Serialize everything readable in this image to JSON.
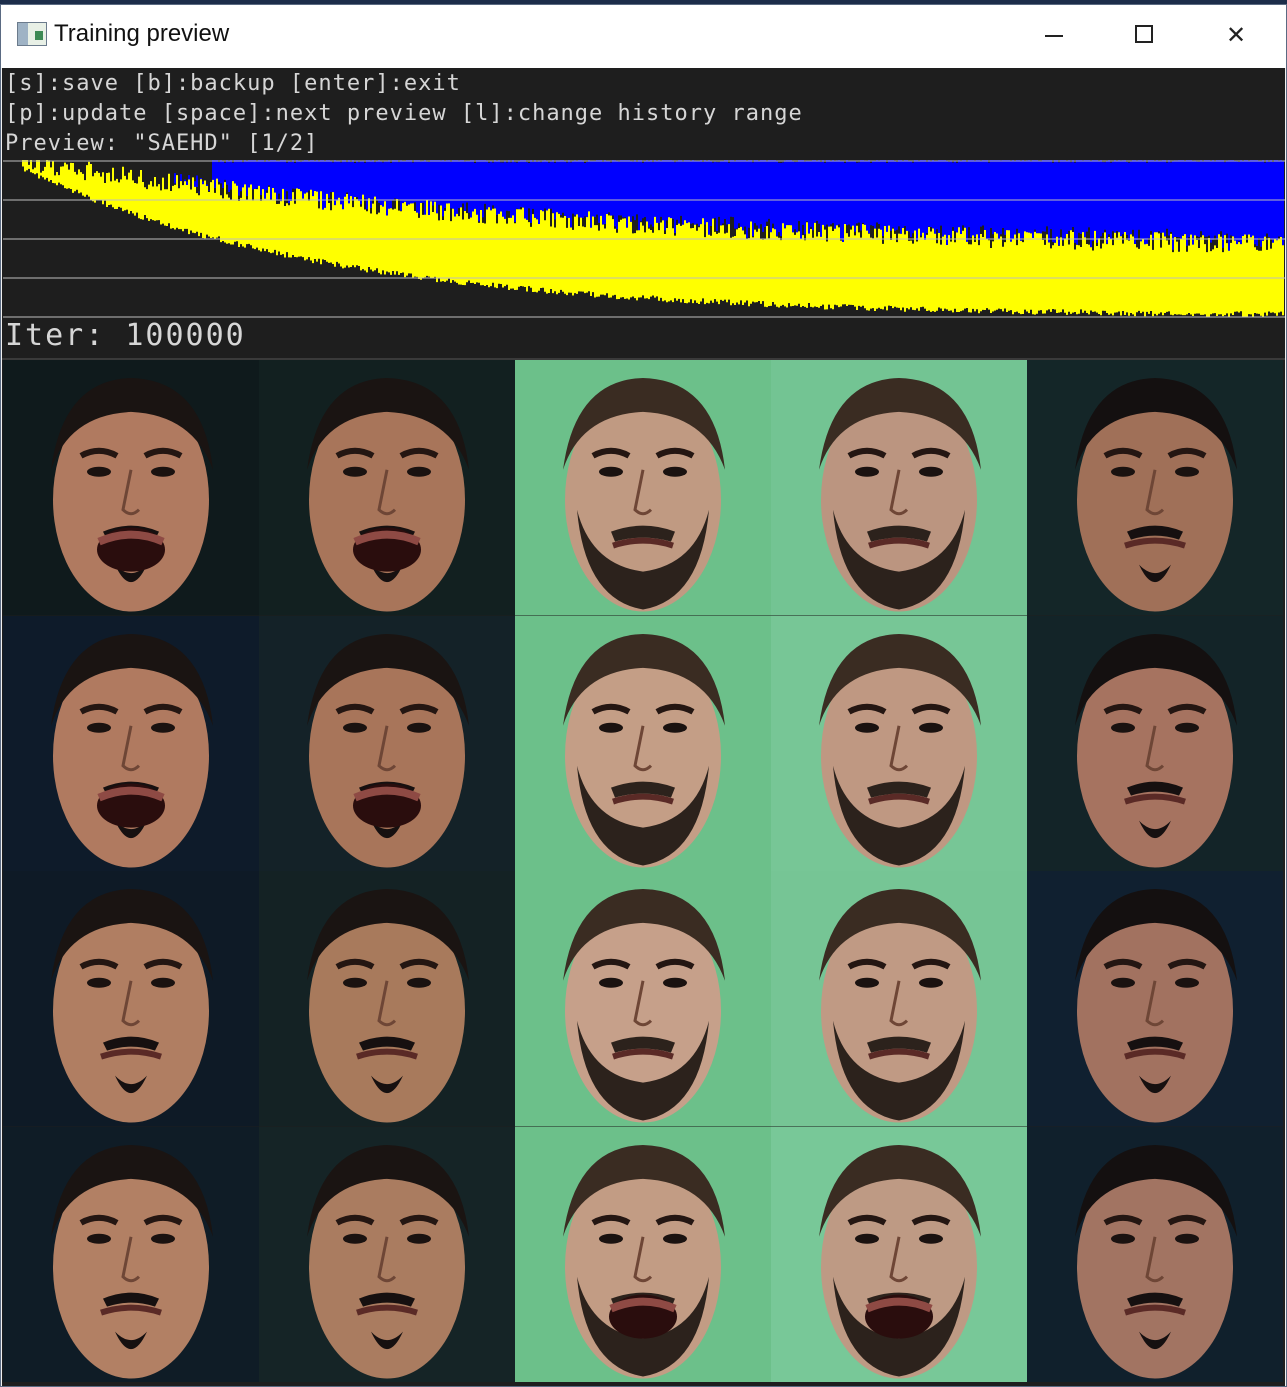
{
  "window": {
    "title": "Training preview",
    "controls": [
      "minimize",
      "maximize",
      "close"
    ]
  },
  "help": {
    "line1": "[s]:save [b]:backup [enter]:exit",
    "line2": "[p]:update [space]:next preview [l]:change history range",
    "line3": "Preview: \"SAEHD\" [1/2]"
  },
  "iter_label": "Iter: 100000",
  "colors": {
    "loss_src": "#ffff00",
    "loss_dst": "#0000ff",
    "background": "#1e1e1e",
    "green_screen": "#6cc08a"
  },
  "preview_grid": {
    "columns": 5,
    "rows": 4,
    "cells": [
      {
        "kind": "src",
        "bg": "#0f1a1c",
        "skin": "#b07a60",
        "hair": "#1a1412",
        "beard": true,
        "mouth_open": true
      },
      {
        "kind": "src-pred",
        "bg": "#122020",
        "skin": "#a8755a",
        "hair": "#1a1412",
        "beard": true,
        "mouth_open": true
      },
      {
        "kind": "dst",
        "bg": "#6cc08a",
        "skin": "#c09a82",
        "hair": "#3a2c22",
        "beard": true,
        "mouth_open": false
      },
      {
        "kind": "dst-pred",
        "bg": "#73c493",
        "skin": "#bb9580",
        "hair": "#3a2c22",
        "beard": true,
        "mouth_open": false
      },
      {
        "kind": "swap",
        "bg": "#142628",
        "skin": "#a07058",
        "hair": "#141010",
        "beard": true,
        "mouth_open": false
      },
      {
        "kind": "src",
        "bg": "#0e1b2a",
        "skin": "#b07a60",
        "hair": "#1a1412",
        "beard": true,
        "mouth_open": true
      },
      {
        "kind": "src-pred",
        "bg": "#142228",
        "skin": "#a8755a",
        "hair": "#1a1412",
        "beard": true,
        "mouth_open": true
      },
      {
        "kind": "dst",
        "bg": "#6cc08a",
        "skin": "#c49e86",
        "hair": "#3a2c22",
        "beard": true,
        "mouth_open": false
      },
      {
        "kind": "dst-pred",
        "bg": "#77c696",
        "skin": "#bf9882",
        "hair": "#3a2c22",
        "beard": true,
        "mouth_open": false
      },
      {
        "kind": "swap",
        "bg": "#132428",
        "skin": "#a67360",
        "hair": "#141010",
        "beard": true,
        "mouth_open": false
      },
      {
        "kind": "src",
        "bg": "#0e1a26",
        "skin": "#b07e62",
        "hair": "#1a1412",
        "beard": true,
        "mouth_open": false
      },
      {
        "kind": "src-pred",
        "bg": "#142224",
        "skin": "#a87a5c",
        "hair": "#1a1412",
        "beard": true,
        "mouth_open": false
      },
      {
        "kind": "dst",
        "bg": "#6cc08a",
        "skin": "#c6a08a",
        "hair": "#3a2c22",
        "beard": true,
        "mouth_open": false
      },
      {
        "kind": "dst-pred",
        "bg": "#76c595",
        "skin": "#c09a84",
        "hair": "#3a2c22",
        "beard": true,
        "mouth_open": false
      },
      {
        "kind": "swap",
        "bg": "#102030",
        "skin": "#a27260",
        "hair": "#141010",
        "beard": true,
        "mouth_open": false
      },
      {
        "kind": "src",
        "bg": "#0f1c26",
        "skin": "#b28064",
        "hair": "#1a1412",
        "beard": true,
        "mouth_open": false
      },
      {
        "kind": "src-pred",
        "bg": "#152426",
        "skin": "#aa7c60",
        "hair": "#1a1412",
        "beard": true,
        "mouth_open": false
      },
      {
        "kind": "dst",
        "bg": "#6cc08a",
        "skin": "#c29c84",
        "hair": "#3a2c22",
        "beard": true,
        "mouth_open": true
      },
      {
        "kind": "dst-pred",
        "bg": "#78c898",
        "skin": "#be9a84",
        "hair": "#3a2c22",
        "beard": true,
        "mouth_open": true
      },
      {
        "kind": "swap",
        "bg": "#10202c",
        "skin": "#a27462",
        "hair": "#141010",
        "beard": true,
        "mouth_open": false
      }
    ]
  }
}
